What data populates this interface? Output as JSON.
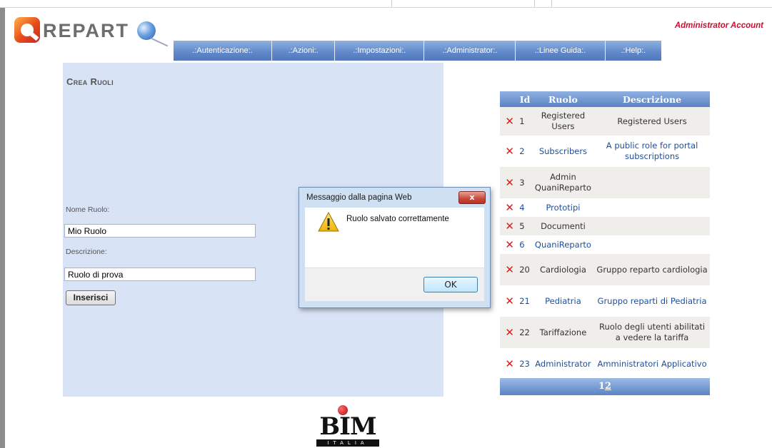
{
  "header": {
    "logo_text": "REPART",
    "admin_account": "Administrator Account"
  },
  "nav": [
    {
      "label": ".:Autenticazione:."
    },
    {
      "label": ".:Azioni:."
    },
    {
      "label": ".:Impostazioni:."
    },
    {
      "label": ".:Administrator:."
    },
    {
      "label": ".:Linee Guida:."
    },
    {
      "label": ".:Help:."
    }
  ],
  "form": {
    "title": "Crea Ruoli",
    "name_label": "Nome Ruolo:",
    "name_value": "Mio Ruolo",
    "desc_label": "Descrizione:",
    "desc_value": "Ruolo di prova",
    "submit_label": "Inserisci"
  },
  "dialog": {
    "title": "Messaggio dalla pagina Web",
    "message": "Ruolo salvato correttamente",
    "ok_label": "OK",
    "close_glyph": "x",
    "icon": "warning-icon"
  },
  "table": {
    "headers": {
      "id": "Id",
      "role": "Ruolo",
      "desc": "Descrizione"
    },
    "delete_glyph": "✕",
    "rows": [
      {
        "id": "1",
        "role": "Registered Users",
        "desc": "Registered Users"
      },
      {
        "id": "2",
        "role": "Subscribers",
        "desc": "A public role for portal subscriptions"
      },
      {
        "id": "3",
        "role": "Admin QuaniReparto",
        "desc": ""
      },
      {
        "id": "4",
        "role": "Prototipi",
        "desc": ""
      },
      {
        "id": "5",
        "role": "Documenti",
        "desc": ""
      },
      {
        "id": "6",
        "role": "QuaniReparto",
        "desc": ""
      },
      {
        "id": "20",
        "role": "Cardiologia",
        "desc": "Gruppo reparto cardiologia"
      },
      {
        "id": "21",
        "role": "Pediatria",
        "desc": "Gruppo reparti di Pediatria"
      },
      {
        "id": "22",
        "role": "Tariffazione",
        "desc": "Ruolo degli utenti abilitati a vedere la tariffa"
      },
      {
        "id": "23",
        "role": "Administrator",
        "desc": "Amministratori Applicativo"
      }
    ],
    "pages": [
      "1",
      "2"
    ]
  },
  "footer": {
    "logo_main": "BIM",
    "logo_sub": "ITALIA"
  },
  "colors": {
    "accent": "#5b82c4",
    "panel": "#d8e3f6",
    "alert": "#c8102e"
  }
}
